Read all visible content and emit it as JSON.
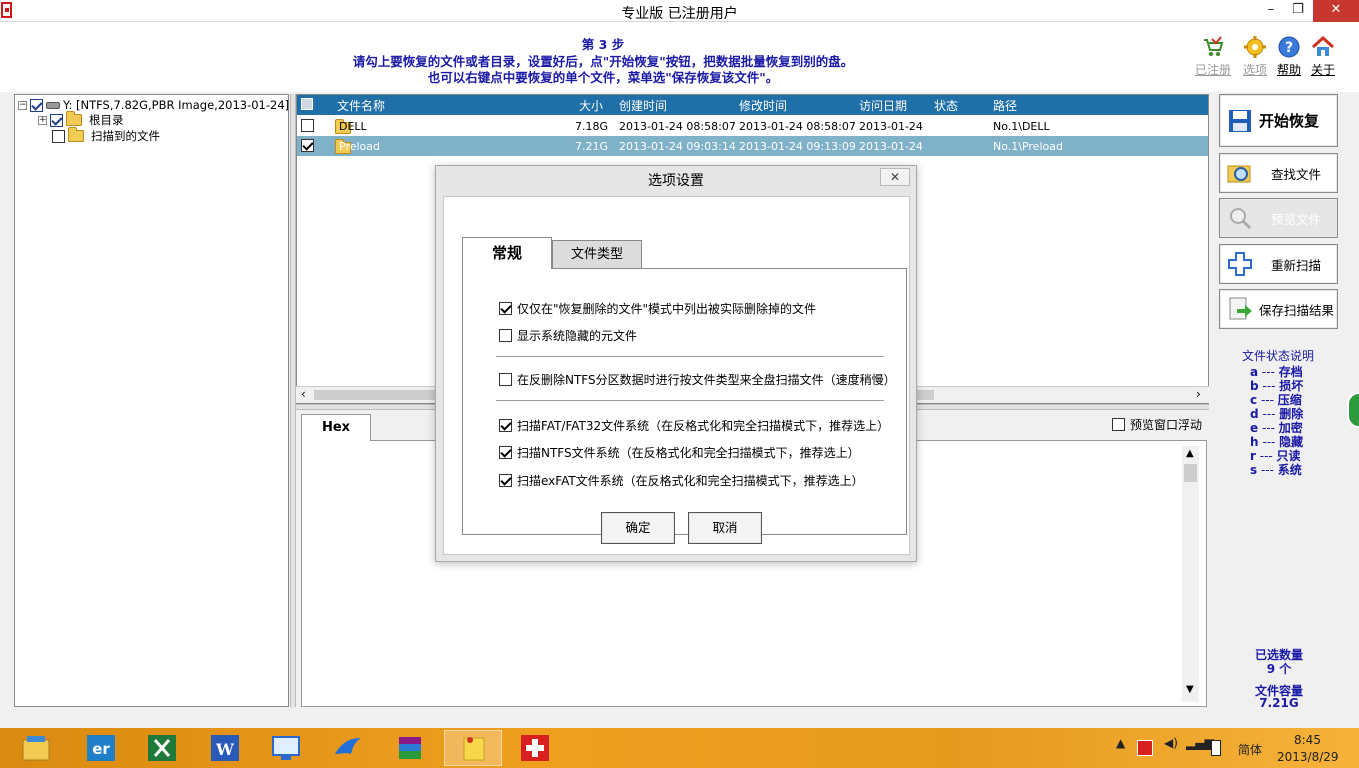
{
  "window": {
    "title": "专业版   已注册用户"
  },
  "header": {
    "step": "第 3 步",
    "line1": "请勾上要恢复的文件或者目录，设置好后，点\"开始恢复\"按钮，把数据批量恢复到别的盘。",
    "line2": "也可以右键点中要恢复的单个文件，菜单选\"保存恢复该文件\"。",
    "icons": [
      {
        "label": "已注册",
        "icon": "cart-icon",
        "enabled": false
      },
      {
        "label": "选项",
        "icon": "gear-icon",
        "enabled": false
      },
      {
        "label": "帮助",
        "icon": "help-icon",
        "enabled": true
      },
      {
        "label": "关于",
        "icon": "house-icon",
        "enabled": true
      }
    ]
  },
  "tree": {
    "drive": "Y:  [NTFS,7.82G,PBR Image,2013-01-24]",
    "root": "根目录",
    "scanned": "扫描到的文件"
  },
  "filelist": {
    "columns": [
      "文件名称",
      "大小",
      "创建时间",
      "修改时间",
      "访问日期",
      "状态",
      "路径"
    ],
    "rows": [
      {
        "name": "DELL",
        "size": "7.18G",
        "created": "2013-01-24 08:58:07",
        "modified": "2013-01-24 08:58:07",
        "accessed": "2013-01-24",
        "status": "",
        "path": "No.1\\DELL",
        "checked": false
      },
      {
        "name": "Preload",
        "size": "7.21G",
        "created": "2013-01-24 09:03:14",
        "modified": "2013-01-24 09:13:09",
        "accessed": "2013-01-24",
        "status": "",
        "path": "No.1\\Preload",
        "checked": true
      }
    ]
  },
  "hex": {
    "tab": "Hex",
    "float_label": "预览窗口浮动"
  },
  "right": {
    "buttons": {
      "start": "开始恢复",
      "find": "查找文件",
      "preview": "预览文件",
      "rescan": "重新扫描",
      "save": "保存扫描结果"
    },
    "legend_title": "文件状态说明",
    "legend": [
      {
        "key": "a",
        "desc": "存档"
      },
      {
        "key": "b",
        "desc": "损坏"
      },
      {
        "key": "c",
        "desc": "压缩"
      },
      {
        "key": "d",
        "desc": "删除"
      },
      {
        "key": "e",
        "desc": "加密"
      },
      {
        "key": "h",
        "desc": "隐藏"
      },
      {
        "key": "r",
        "desc": "只读"
      },
      {
        "key": "s",
        "desc": "系统"
      }
    ],
    "selected_label": "已选数量",
    "selected_value": "9 个",
    "size_label": "文件容量",
    "size_value": "7.21G"
  },
  "dialog": {
    "title": "选项设置",
    "close": "✕",
    "tabs": [
      "常规",
      "文件类型"
    ],
    "options": [
      {
        "label": "仅仅在\"恢复删除的文件\"模式中列出被实际删除掉的文件",
        "checked": true
      },
      {
        "label": "显示系统隐藏的元文件",
        "checked": false
      },
      {
        "label": "在反删除NTFS分区数据时进行按文件类型来全盘扫描文件（速度稍慢）",
        "checked": false
      },
      {
        "label": "扫描FAT/FAT32文件系统（在反格式化和完全扫描模式下，推荐选上）",
        "checked": true
      },
      {
        "label": "扫描NTFS文件系统（在反格式化和完全扫描模式下，推荐选上）",
        "checked": true
      },
      {
        "label": "扫描exFAT文件系统（在反格式化和完全扫描模式下，推荐选上）",
        "checked": true
      }
    ],
    "ok": "确定",
    "cancel": "取消"
  },
  "taskbar": {
    "lang": "简体",
    "time": "8:45",
    "date": "2013/8/29"
  }
}
